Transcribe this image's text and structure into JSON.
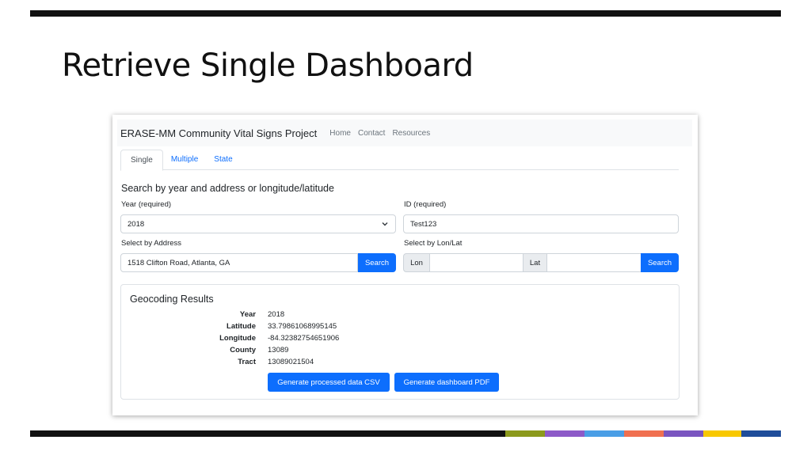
{
  "slide": {
    "title": "Retrieve Single Dashboard",
    "bottom_bar_colors": [
      "#111111",
      "#8c9a1c",
      "#8d5ac8",
      "#4a9ee6",
      "#f07050",
      "#7a55c0",
      "#f8c800",
      "#1f4d9a"
    ]
  },
  "app": {
    "brand": "ERASE-MM Community Vital Signs Project",
    "nav": [
      "Home",
      "Contact",
      "Resources"
    ],
    "tabs": [
      {
        "label": "Single",
        "active": true
      },
      {
        "label": "Multiple",
        "active": false
      },
      {
        "label": "State",
        "active": false
      }
    ],
    "heading": "Search by year and address or longitude/latitude",
    "year": {
      "label": "Year (required)",
      "value": "2018"
    },
    "id": {
      "label": "ID (required)",
      "value": "Test123"
    },
    "address": {
      "label": "Select by Address",
      "value": "1518 Clifton Road, Atlanta, GA",
      "button": "Search"
    },
    "lonlat": {
      "label": "Select by Lon/Lat",
      "lon_label": "Lon",
      "lat_label": "Lat",
      "lon_value": "",
      "lat_value": "",
      "button": "Search"
    },
    "results": {
      "title": "Geocoding Results",
      "rows": [
        {
          "key": "Year",
          "value": "2018"
        },
        {
          "key": "Latitude",
          "value": "33.79861068995145"
        },
        {
          "key": "Longitude",
          "value": "-84.32382754651906"
        },
        {
          "key": "County",
          "value": "13089"
        },
        {
          "key": "Tract",
          "value": "13089021504"
        }
      ],
      "csv_button": "Generate processed data CSV",
      "pdf_button": "Generate dashboard PDF"
    },
    "accent_color": "#0d6efd"
  }
}
